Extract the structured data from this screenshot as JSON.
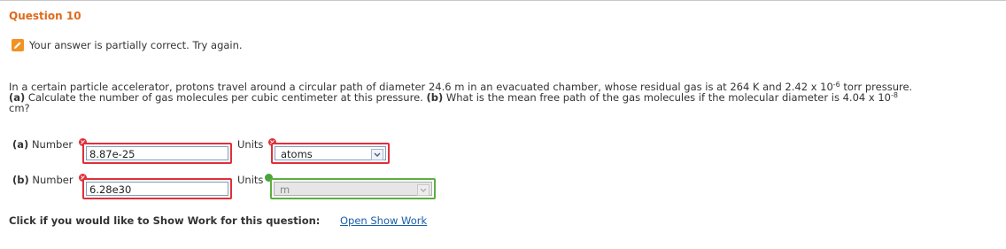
{
  "question": {
    "title": "Question 10"
  },
  "status": {
    "message": "Your answer is partially correct.  Try again."
  },
  "problem": {
    "intro": "In a certain particle accelerator, protons travel around a circular path of diameter 24.6 m in an evacuated chamber, whose residual gas is at 264 K and 2.42 x 10",
    "pressure_exp": "-6",
    "pressure_unit": " torr pressure.",
    "part_a_tag": "(a)",
    "part_a_text": " Calculate the number of gas molecules per cubic centimeter at this pressure. ",
    "part_b_tag": "(b)",
    "part_b_text": " What is the mean free path of the gas molecules if the molecular diameter is 4.04 x 10",
    "diameter_exp": "-8",
    "diameter_unit": "cm?"
  },
  "answers": {
    "a": {
      "tag": "(a)",
      "number_label": "Number",
      "number_value": "8.87e-25",
      "units_label": "Units",
      "units_value": "atoms",
      "number_status": "incorrect",
      "units_status": "incorrect"
    },
    "b": {
      "tag": "(b)",
      "number_label": "Number",
      "number_value": "6.28e30",
      "units_label": "Units",
      "units_value": "m",
      "number_status": "incorrect",
      "units_status": "correct"
    }
  },
  "show_work": {
    "prompt": "Click if you would like to Show Work for this question:",
    "link_label": "Open Show Work"
  },
  "colors": {
    "title": "#e06a1b",
    "incorrect": "#e0303a",
    "correct": "#5bb03f",
    "link": "#1a5ea8"
  },
  "icons": {
    "status": "pencil-icon",
    "incorrect": "x-icon",
    "correct": "check-icon",
    "dropdown": "chevron-down-icon"
  }
}
